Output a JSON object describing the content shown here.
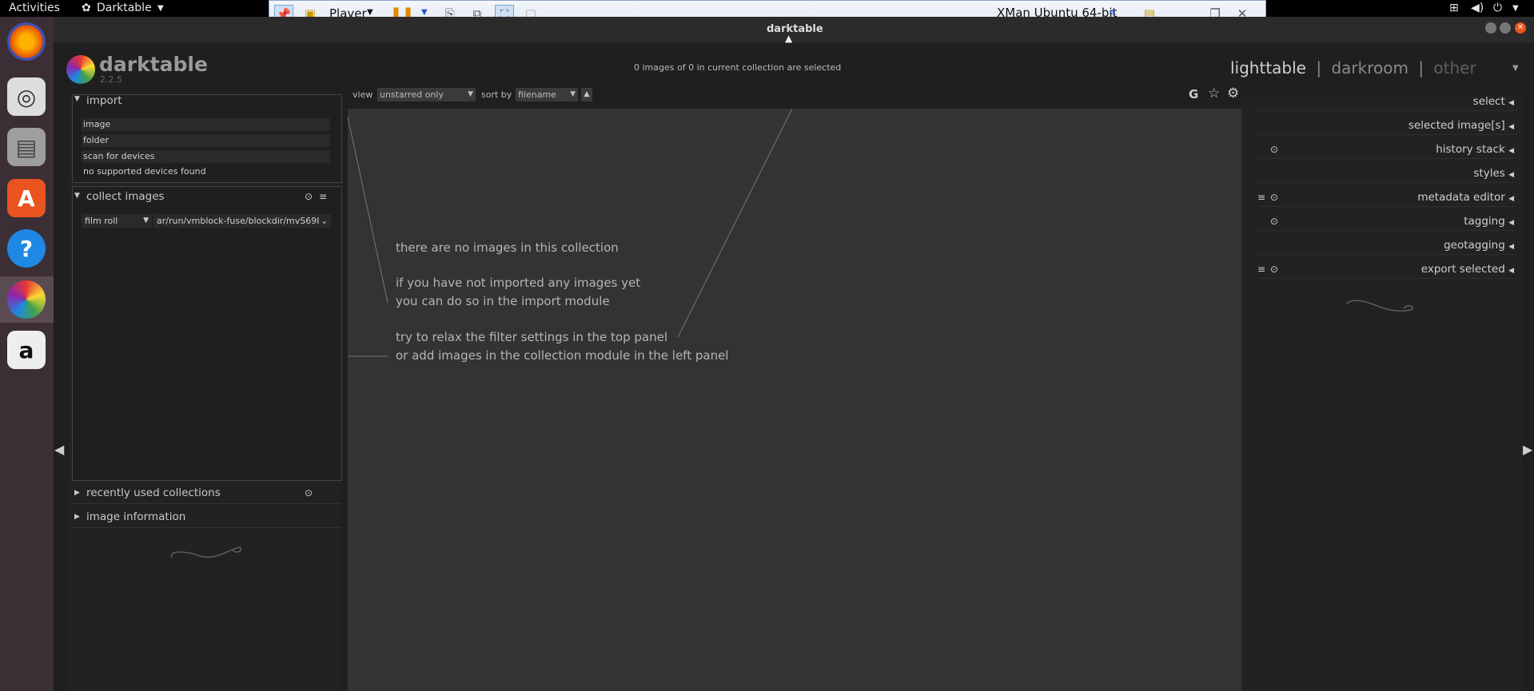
{
  "system_bar": {
    "activities": "Activities",
    "app_menu": "Darktable"
  },
  "vm_toolbar": {
    "player": "Player",
    "vm_name": "XMan Ubuntu 64-bit"
  },
  "window": {
    "title": "darktable"
  },
  "app": {
    "name": "darktable",
    "version": "2.2.5"
  },
  "header": {
    "selection_status": "0 images of 0 in current collection are selected"
  },
  "views": {
    "lighttable": "lighttable",
    "separator": "|",
    "darkroom": "darkroom",
    "other": "other"
  },
  "filter": {
    "view_label": "view",
    "view_value": "unstarred only",
    "sort_label": "sort by",
    "sort_value": "filename"
  },
  "left_panel": {
    "import": {
      "title": "import",
      "buttons": [
        "image",
        "folder",
        "scan for devices"
      ],
      "status": "no supported devices found"
    },
    "collect": {
      "title": "collect images",
      "property": "film roll",
      "value": "ar/run/vmblock-fuse/blockdir/mvS69I"
    },
    "recent": {
      "title": "recently used collections"
    },
    "info": {
      "title": "image information"
    }
  },
  "center": {
    "lines": [
      "there are no images in this collection",
      "if you have not imported any images yet",
      "you can do so in the import module",
      "try to relax the filter settings in the top panel",
      "or add images in the collection module in the left panel"
    ]
  },
  "right_panel": {
    "modules": [
      "select",
      "selected image[s]",
      "history stack",
      "styles",
      "metadata editor",
      "tagging",
      "geotagging",
      "export selected"
    ]
  },
  "colors": {
    "accent": "#e95420",
    "bg": "#222222",
    "center_bg": "#333333"
  }
}
